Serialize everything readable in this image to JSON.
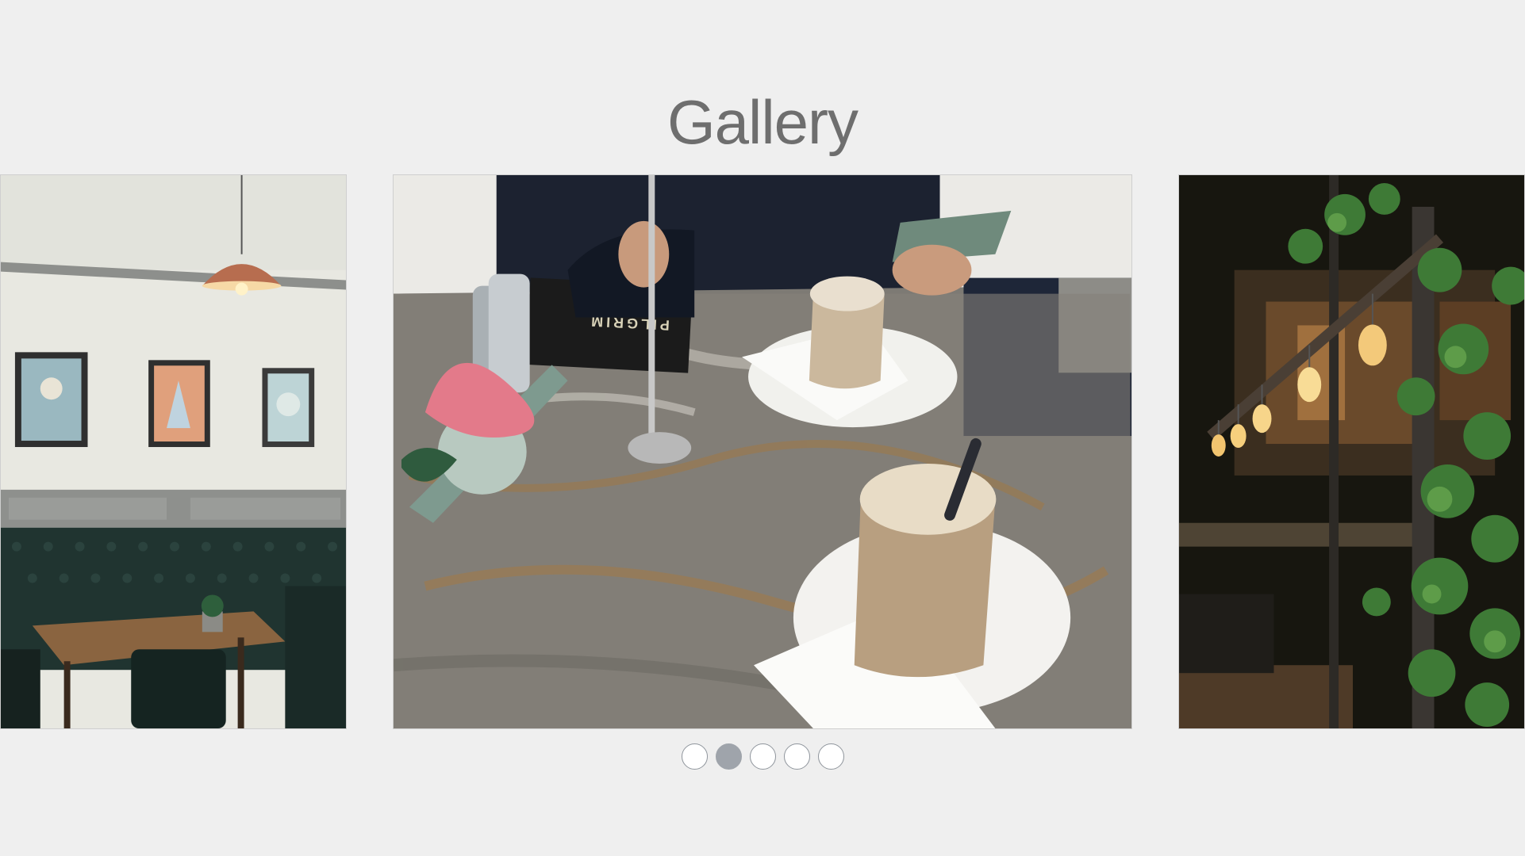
{
  "gallery": {
    "title": "Gallery",
    "slides": [
      {
        "name": "cafe-interior-booth"
      },
      {
        "name": "coffee-on-wooden-table"
      },
      {
        "name": "bar-with-hanging-bulbs"
      }
    ],
    "active_dot": 2,
    "dot_count": 5
  },
  "photo_text": {
    "menu_text": "PILGRIM"
  },
  "colors": {
    "background": "#efefef",
    "title": "#6e6e6e",
    "dot_active": "#9fa4ab",
    "dot_inactive": "#ffffff"
  }
}
